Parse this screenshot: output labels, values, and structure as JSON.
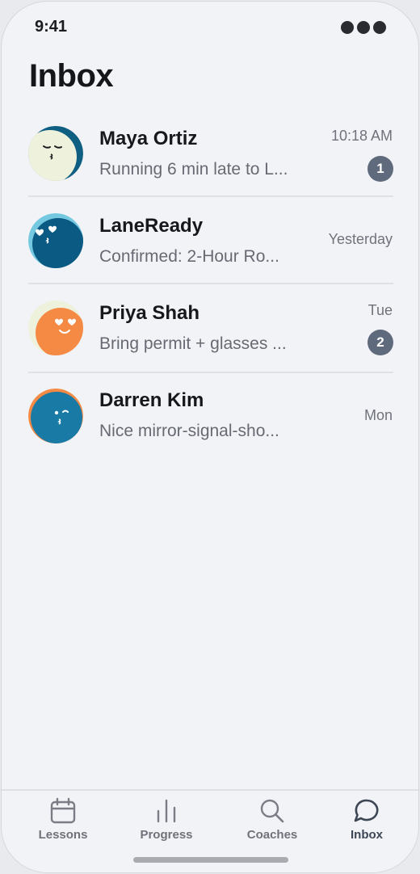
{
  "status_bar": {
    "time": "9:41"
  },
  "header": {
    "title": "Inbox"
  },
  "conversations": [
    {
      "name": "Maya Ortiz",
      "preview": "Running 6 min late to L...",
      "time": "10:18 AM",
      "unread": "1",
      "avatar_bg": "#eef1dc",
      "avatar_ring": "#0f5f83"
    },
    {
      "name": "LaneReady",
      "preview": "Confirmed: 2-Hour Ro...",
      "time": "Yesterday",
      "unread": null,
      "avatar_bg": "#0b5a83",
      "avatar_ring": "#74c8e0"
    },
    {
      "name": "Priya Shah",
      "preview": "Bring permit + glasses ...",
      "time": "Tue",
      "unread": "2",
      "avatar_bg": "#f58a45",
      "avatar_ring": "#eef1dc"
    },
    {
      "name": "Darren Kim",
      "preview": "Nice mirror-signal-sho...",
      "time": "Mon",
      "unread": null,
      "avatar_bg": "#1a7aa6",
      "avatar_ring": "#f58a45"
    }
  ],
  "tabbar": {
    "tabs": [
      {
        "label": "Lessons",
        "icon": "calendar-icon"
      },
      {
        "label": "Progress",
        "icon": "bar-chart-icon"
      },
      {
        "label": "Coaches",
        "icon": "search-icon"
      },
      {
        "label": "Inbox",
        "icon": "chat-bubble-icon",
        "active": true
      }
    ]
  },
  "colors": {
    "badge": "#5f6a7d",
    "background": "#f2f3f6"
  }
}
